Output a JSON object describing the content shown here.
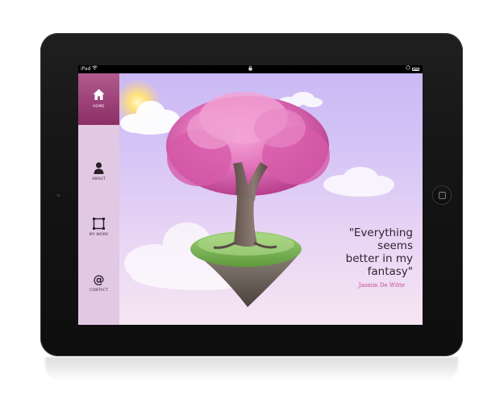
{
  "status_bar": {
    "carrier": "iPad",
    "wifi_icon": "wifi-icon",
    "lock_icon": "lock-icon",
    "battery_icon": "battery-icon"
  },
  "nav": {
    "items": [
      {
        "label": "HOME",
        "icon": "home-icon",
        "active": true
      },
      {
        "label": "ABOUT",
        "icon": "person-icon",
        "active": false
      },
      {
        "label": "MY WORK",
        "icon": "frame-icon",
        "active": false
      },
      {
        "label": "CONTACT",
        "icon": "at-icon",
        "active": false
      }
    ]
  },
  "quote": {
    "lines": [
      "\"Everything",
      "seems",
      "better in my",
      "fantasy\""
    ],
    "author": "Jasmin De Witte"
  },
  "colors": {
    "accent": "#b25a8e",
    "sidebar": "#e1c8e3",
    "author": "#c24d96",
    "sky_top": "#c9b8f4",
    "sky_bottom": "#f6e6f3"
  }
}
